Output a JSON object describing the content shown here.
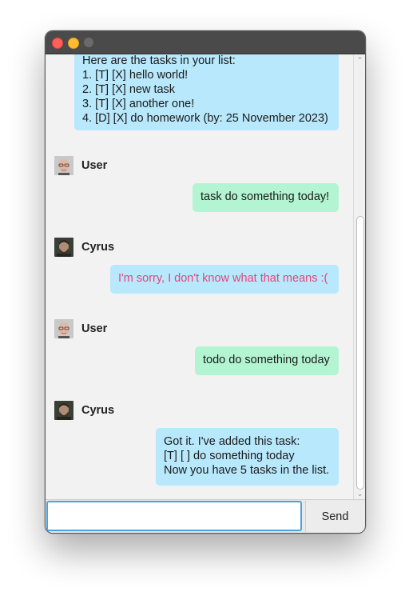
{
  "chat": {
    "messages": [
      {
        "sender": "Cyrus",
        "type": "bot",
        "lines": [
          "Here are the tasks in your list:",
          "1. [T] [X] hello world!",
          "2. [T] [X] new task",
          "3. [T] [X] another one!",
          "4. [D] [X] do homework (by: 25 November 2023)"
        ]
      },
      {
        "sender": "User",
        "type": "user",
        "lines": [
          "task do something today!"
        ]
      },
      {
        "sender": "Cyrus",
        "type": "error",
        "lines": [
          "I'm sorry, I don't know what that means :("
        ]
      },
      {
        "sender": "User",
        "type": "user",
        "lines": [
          "todo do something today"
        ]
      },
      {
        "sender": "Cyrus",
        "type": "bot",
        "lines": [
          "Got it. I've added this task:",
          "[T] [ ] do something today",
          "Now you have 5 tasks in the list."
        ]
      }
    ]
  },
  "senders": {
    "user": "User",
    "bot": "Cyrus"
  },
  "input": {
    "value": "",
    "placeholder": ""
  },
  "send_button": {
    "label": "Send"
  },
  "colors": {
    "bot_bubble": "#b8e8fc",
    "user_bubble": "#b3f5d2",
    "error_text": "#e8437c",
    "input_focus": "#4aa3df"
  },
  "icons": [
    "close-light",
    "minimize-light",
    "zoom-light",
    "scroll-up-arrow",
    "scroll-down-arrow"
  ]
}
